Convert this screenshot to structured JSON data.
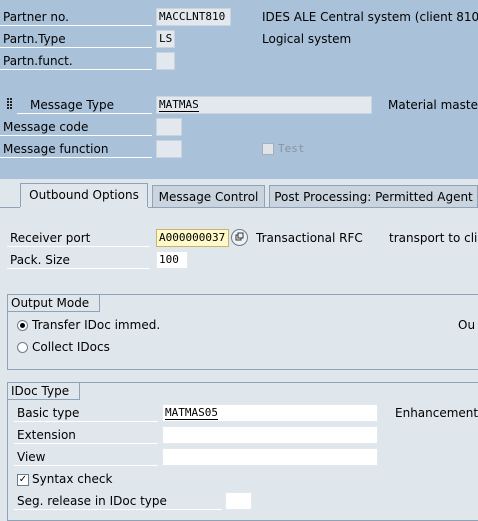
{
  "header": {
    "partner_no_label": "Partner no.",
    "partner_no_value": "MACCLNT810",
    "partner_desc": "IDES ALE Central system (client 810",
    "partn_type_label": "Partn.Type",
    "partn_type_value": "LS",
    "partn_type_desc": "Logical system",
    "partn_funct_label": "Partn.funct.",
    "partn_funct_value": "",
    "message_type_label": "Message Type",
    "message_type_value": "MATMAS",
    "message_type_desc": "Material master",
    "message_code_label": "Message code",
    "message_code_value": "",
    "message_function_label": "Message function",
    "message_function_value": "",
    "test_label": "Test"
  },
  "tabs": [
    {
      "label": "Outbound Options"
    },
    {
      "label": "Message Control"
    },
    {
      "label": "Post Processing: Permitted Agent"
    }
  ],
  "outbound": {
    "receiver_port_label": "Receiver port",
    "receiver_port_value": "A000000037",
    "port_type": "Transactional RFC",
    "port_desc": "transport to clie",
    "pack_size_label": "Pack. Size",
    "pack_size_value": "100"
  },
  "output_mode": {
    "title": "Output Mode",
    "transfer_label": "Transfer IDoc immed.",
    "collect_label": "Collect IDocs",
    "right_truncated": "Ou"
  },
  "idoc_type": {
    "title": "IDoc Type",
    "basic_type_label": "Basic type",
    "basic_type_value": "MATMAS05",
    "enhancement_label": "Enhancement:",
    "extension_label": "Extension",
    "extension_value": "",
    "view_label": "View",
    "view_value": "",
    "syntax_check_label": "Syntax check",
    "seg_release_label": "Seg. release in IDoc type",
    "seg_release_value": ""
  }
}
